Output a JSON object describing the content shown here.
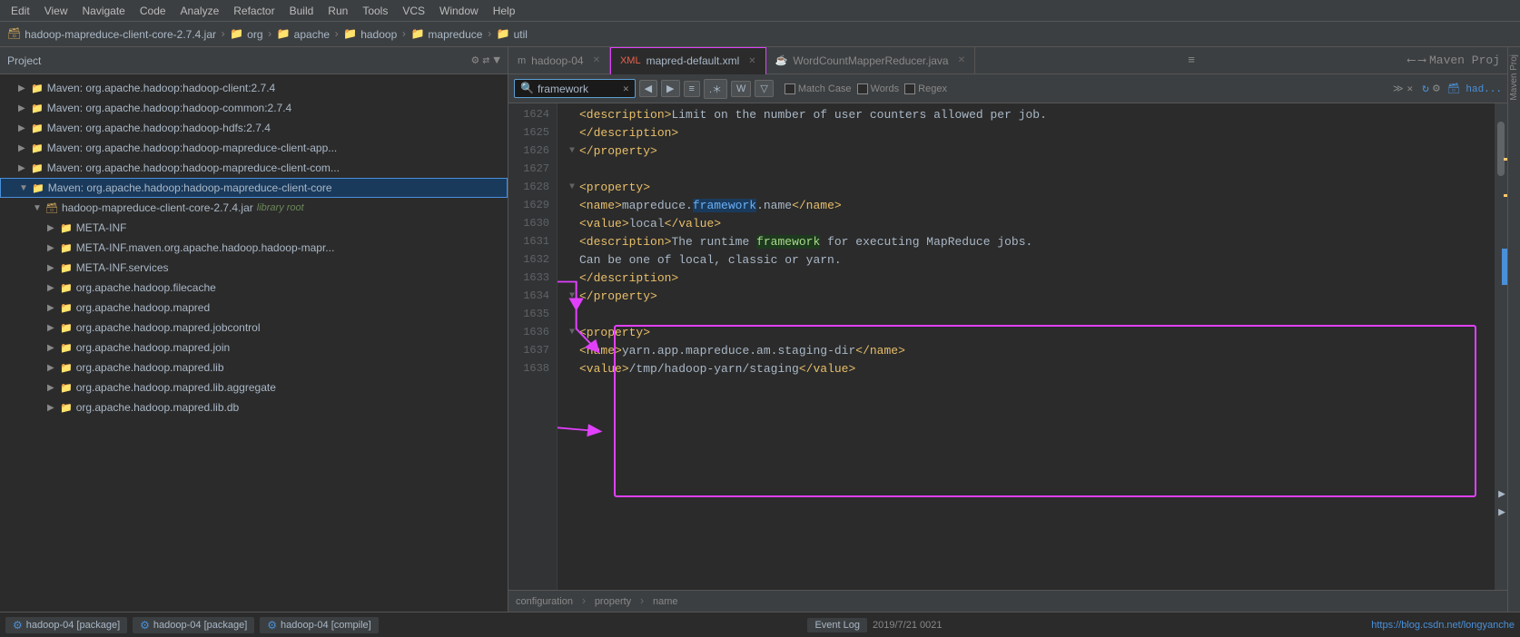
{
  "menu": {
    "items": [
      "Edit",
      "View",
      "Navigate",
      "Code",
      "Analyze",
      "Refactor",
      "Build",
      "Run",
      "Tools",
      "VCS",
      "Window",
      "Help"
    ]
  },
  "breadcrumb": {
    "items": [
      "hadoop-mapreduce-client-core-2.7.4.jar",
      "org",
      "apache",
      "hadoop",
      "mapreduce",
      "util"
    ]
  },
  "left_panel": {
    "title": "Project",
    "tree_items": [
      {
        "indent": 1,
        "arrow": "▶",
        "icon": "📁",
        "text": "Maven: org.apache.hadoop:hadoop-client:2.7.4",
        "selected": false
      },
      {
        "indent": 1,
        "arrow": "▶",
        "icon": "📁",
        "text": "Maven: org.apache.hadoop:hadoop-common:2.7.4",
        "selected": false
      },
      {
        "indent": 1,
        "arrow": "▶",
        "icon": "📁",
        "text": "Maven: org.apache.hadoop:hadoop-hdfs:2.7.4",
        "selected": false
      },
      {
        "indent": 1,
        "arrow": "▶",
        "icon": "📁",
        "text": "Maven: org.apache.hadoop:hadoop-mapreduce-client-app...",
        "selected": false
      },
      {
        "indent": 1,
        "arrow": "▶",
        "icon": "📁",
        "text": "Maven: org.apache.hadoop:hadoop-mapreduce-client-com...",
        "selected": false
      },
      {
        "indent": 1,
        "arrow": "▼",
        "icon": "📁",
        "text": "Maven: org.apache.hadoop:hadoop-mapreduce-client-core",
        "selected": true,
        "highlighted": true
      },
      {
        "indent": 2,
        "arrow": "▼",
        "icon": "🗃",
        "text": "hadoop-mapreduce-client-core-2.7.4.jar",
        "lib_text": "library root",
        "selected": false
      },
      {
        "indent": 3,
        "arrow": "▶",
        "icon": "📁",
        "text": "META-INF",
        "selected": false
      },
      {
        "indent": 3,
        "arrow": "▶",
        "icon": "📁",
        "text": "META-INF.maven.org.apache.hadoop.hadoop-mapr...",
        "selected": false
      },
      {
        "indent": 3,
        "arrow": "▶",
        "icon": "📁",
        "text": "META-INF.services",
        "selected": false
      },
      {
        "indent": 3,
        "arrow": "▶",
        "icon": "📁",
        "text": "org.apache.hadoop.filecache",
        "selected": false
      },
      {
        "indent": 3,
        "arrow": "▶",
        "icon": "📁",
        "text": "org.apache.hadoop.mapred",
        "selected": false
      },
      {
        "indent": 3,
        "arrow": "▶",
        "icon": "📁",
        "text": "org.apache.hadoop.mapred.jobcontrol",
        "selected": false
      },
      {
        "indent": 3,
        "arrow": "▶",
        "icon": "📁",
        "text": "org.apache.hadoop.mapred.join",
        "selected": false
      },
      {
        "indent": 3,
        "arrow": "▶",
        "icon": "📁",
        "text": "org.apache.hadoop.mapred.lib",
        "selected": false
      },
      {
        "indent": 3,
        "arrow": "▶",
        "icon": "📁",
        "text": "org.apache.hadoop.mapred.lib.aggregate",
        "selected": false
      },
      {
        "indent": 3,
        "arrow": "▶",
        "icon": "📁",
        "text": "org.apache.hadoop.mapred.lib.db",
        "selected": false
      }
    ]
  },
  "tabs": [
    {
      "icon": "m",
      "label": "hadoop-04",
      "active": false,
      "color": "#888"
    },
    {
      "icon": "xml",
      "label": "mapred-default.xml",
      "active": true,
      "color": "#e8604c"
    },
    {
      "icon": "java",
      "label": "WordCountMapperReducer.java",
      "active": false,
      "color": "#4a90d9"
    }
  ],
  "search": {
    "value": "framework",
    "placeholder": "Search...",
    "match_case_label": "Match Case",
    "words_label": "Words",
    "regex_label": "Regex"
  },
  "code_lines": [
    {
      "num": 1624,
      "fold": false,
      "content": "<description>Limit on the number of user counters allowed per job.",
      "type": "xml"
    },
    {
      "num": 1625,
      "fold": false,
      "content": "    </description>",
      "type": "xml"
    },
    {
      "num": 1626,
      "fold": true,
      "content": "</property>",
      "type": "xml"
    },
    {
      "num": 1627,
      "fold": false,
      "content": "",
      "type": "empty"
    },
    {
      "num": 1628,
      "fold": true,
      "content": "<property>",
      "type": "xml"
    },
    {
      "num": 1629,
      "fold": false,
      "content": "    <name>mapreduce.framework.name</name>",
      "type": "xml",
      "highlight": "framework"
    },
    {
      "num": 1630,
      "fold": false,
      "content": "    <value>local</value>",
      "type": "xml"
    },
    {
      "num": 1631,
      "fold": false,
      "content": "    <description>The runtime framework for executing MapReduce jobs.",
      "type": "xml",
      "highlight": "framework"
    },
    {
      "num": 1632,
      "fold": false,
      "content": "        Can be one of local, classic or yarn.",
      "type": "xml"
    },
    {
      "num": 1633,
      "fold": false,
      "content": "    </description>",
      "type": "xml"
    },
    {
      "num": 1634,
      "fold": true,
      "content": "</property>",
      "type": "xml"
    },
    {
      "num": 1635,
      "fold": false,
      "content": "",
      "type": "empty"
    },
    {
      "num": 1636,
      "fold": true,
      "content": "<property>",
      "type": "xml"
    },
    {
      "num": 1637,
      "fold": false,
      "content": "    <name>yarn.app.mapreduce.am.staging-dir</name>",
      "type": "xml"
    },
    {
      "num": 1638,
      "fold": false,
      "content": "    <value>/tmp/hadoop-yarn/staging</value>",
      "type": "xml"
    }
  ],
  "status_breadcrumb": {
    "parts": [
      "configuration",
      "property",
      "name"
    ]
  },
  "bottom_bar": {
    "run_items": [
      {
        "icon": "⚙",
        "text": "hadoop-04 [package]"
      },
      {
        "icon": "⚙",
        "text": "hadoop-04 [package]"
      },
      {
        "icon": "⚙",
        "text": "hadoop-04 [compile]"
      }
    ],
    "event_log": "Event Log",
    "timestamp": "2019/7/21 0021",
    "url": "https://blog.csdn.net/longyanche"
  },
  "maven_panel": {
    "label": "Maven Proj"
  }
}
